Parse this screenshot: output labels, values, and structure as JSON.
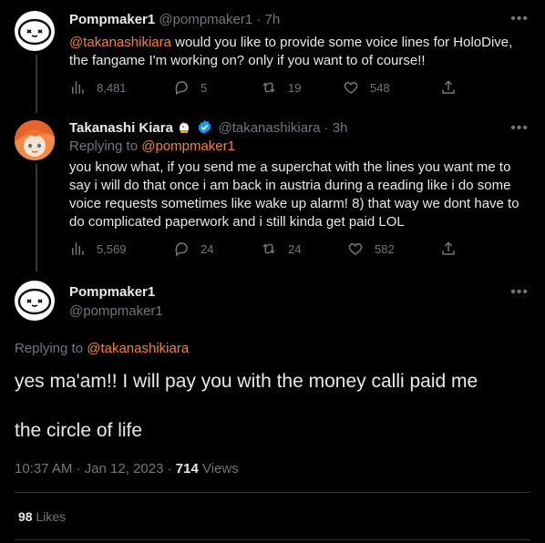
{
  "tweet1": {
    "name": "Pompmaker1",
    "handle": "@pompmaker1",
    "time": "· 7h",
    "mention": "@takanashikiara",
    "text_line1": " would you like to provide some voice lines for HoloDive,",
    "text_line2": "the fangame I'm working on? only if you want to of course!!",
    "views": "8,481",
    "replies": "5",
    "retweets": "19",
    "likes": "548"
  },
  "tweet2": {
    "name": "Takanashi Kiara",
    "handle": "@takanashikiara",
    "time": "· 3h",
    "replying_prefix": "Replying to ",
    "replying_to": "@pompmaker1",
    "lines": [
      "you know what, if you send me a superchat with the lines you want me to",
      "say i will do that once i am back in austria during a reading like i do some",
      "voice requests sometimes like wake up alarm! 8) that way we dont have to",
      "do complicated paperwork and i still kinda get paid LOL"
    ],
    "views": "5,569",
    "replies": "24",
    "retweets": "24",
    "likes": "582"
  },
  "main_tweet": {
    "name": "Pompmaker1",
    "handle": "@pompmaker1",
    "replying_prefix": "Replying to ",
    "replying_to": "@takanashikiara",
    "line1": "yes ma'am!! I will pay you with the money calli paid me",
    "line2": "the circle of life",
    "timestamp": "10:37 AM · Jan 12, 2023 · ",
    "views_count": "714",
    "views_label": " Views",
    "likes_count": "98",
    "likes_label": " Likes"
  },
  "colors": {
    "background": "#000000",
    "text": "#e7e9ea",
    "muted": "#71767b",
    "accent": "#f4812d",
    "verified": "#1d9bf0"
  },
  "icons": [
    "views-icon",
    "reply-icon",
    "retweet-icon",
    "like-icon",
    "share-icon",
    "verified-badge-icon",
    "more-icon",
    "chick-emoji-icon"
  ]
}
